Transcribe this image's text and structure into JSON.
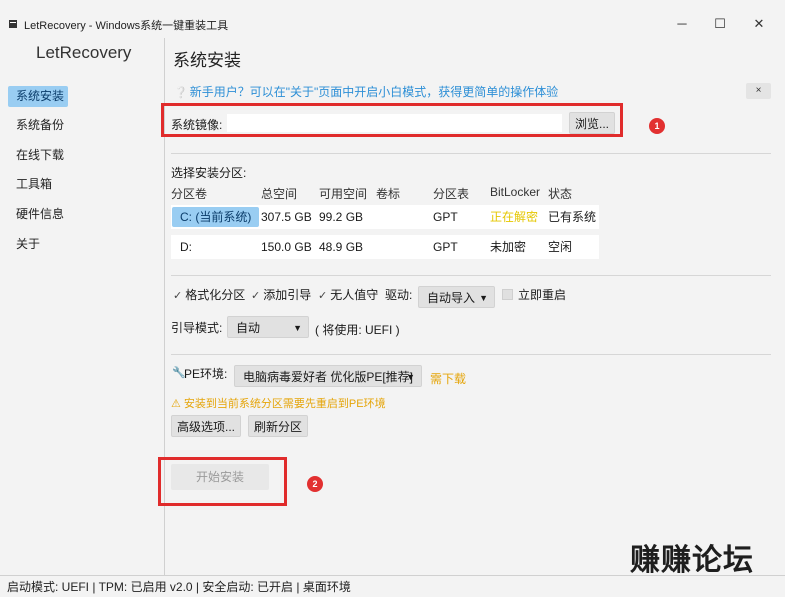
{
  "window": {
    "title": "LetRecovery - Windows系统一键重装工具",
    "minimize_glyph": "─",
    "maximize_glyph": "☐",
    "close_glyph": "✕"
  },
  "sidebar": {
    "app_name": "LetRecovery",
    "items": [
      {
        "label": "系统安装",
        "active": true
      },
      {
        "label": "系统备份",
        "active": false
      },
      {
        "label": "在线下载",
        "active": false
      },
      {
        "label": "工具箱",
        "active": false
      },
      {
        "label": "硬件信息",
        "active": false
      },
      {
        "label": "关于",
        "active": false
      }
    ]
  },
  "main": {
    "page_title": "系统安装",
    "tip": {
      "icon": "chat-bubble-icon",
      "text": "新手用户？可以在\"关于\"页面中开启小白模式，获得更简单的操作体验",
      "close_label": "×"
    },
    "image": {
      "label": "系统镜像:",
      "value": "",
      "placeholder": "",
      "browse_label": "浏览..."
    },
    "partition": {
      "section_label": "选择安装分区:",
      "columns": [
        "分区卷",
        "总空间",
        "可用空间",
        "卷标",
        "分区表",
        "BitLocker",
        "状态"
      ],
      "rows": [
        {
          "volume": "C: (当前系统)",
          "total": "307.5 GB",
          "free": "99.2 GB",
          "label": "",
          "table": "GPT",
          "bitlocker": "正在解密",
          "status": "已有系统",
          "selected": true
        },
        {
          "volume": "D:",
          "total": "150.0 GB",
          "free": "48.9 GB",
          "label": "",
          "table": "GPT",
          "bitlocker": "未加密",
          "status": "空闲",
          "selected": false
        }
      ]
    },
    "options": {
      "format": "格式化分区",
      "add_boot": "添加引导",
      "unattended": "无人值守",
      "driver_label": "驱动:",
      "driver_value": "自动导入",
      "reboot": "立即重启",
      "boot_mode_label": "引导模式:",
      "boot_mode_value": "自动",
      "boot_mode_note": "( 将使用: UEFI )"
    },
    "pe": {
      "label": "PE环境:",
      "value": "电脑病毒爱好者 优化版PE[推荐]",
      "need_download": "需下载",
      "warning": "⚠ 安装到当前系统分区需要先重启到PE环境",
      "advanced_label": "高级选项...",
      "refresh_label": "刷新分区"
    },
    "start_label": "开始安装"
  },
  "annotations": {
    "badge_1": "1",
    "badge_2": "2",
    "watermark": "赚赚论坛"
  },
  "statusbar": {
    "text": "启动模式: UEFI | TPM: 已启用 v2.0 | 安全启动: 已开启 | 桌面环境"
  },
  "colors": {
    "accent": "#99cdf2",
    "tip_text": "#2d8fd6",
    "warning": "#e5a50a",
    "bitlocker_decrypting": "#e5c700",
    "highlight_red": "#e02b2b"
  }
}
